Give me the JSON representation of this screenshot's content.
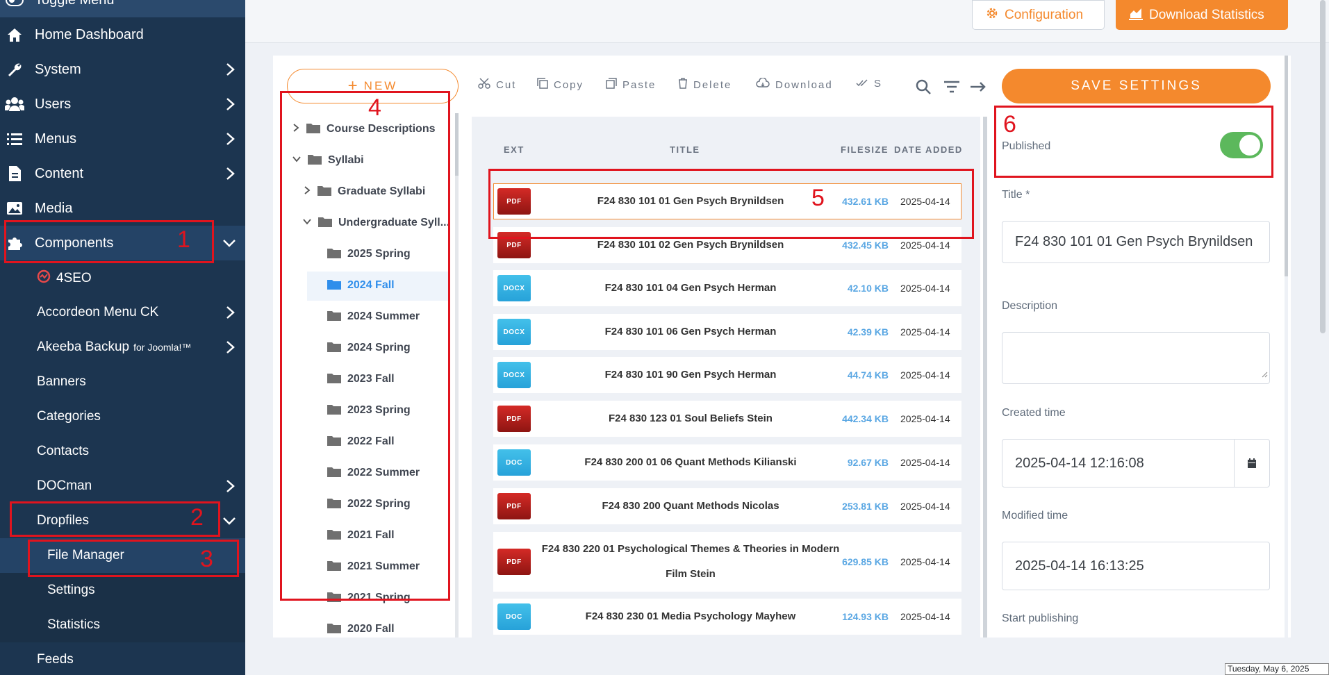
{
  "sidebar": {
    "toggle_label": "Toggle Menu",
    "items": [
      {
        "label": "Home Dashboard",
        "icon": "home-icon"
      },
      {
        "label": "System",
        "icon": "wrench-icon"
      },
      {
        "label": "Users",
        "icon": "users-icon"
      },
      {
        "label": "Menus",
        "icon": "list-icon"
      },
      {
        "label": "Content",
        "icon": "file-icon"
      },
      {
        "label": "Media",
        "icon": "image-icon"
      },
      {
        "label": "Components",
        "icon": "puzzle-icon"
      }
    ],
    "components": {
      "foursEO": "4SEO",
      "accordeon": "Accordeon Menu CK",
      "akeeba": "Akeeba Backup",
      "akeeba_suffix": "for Joomla!™",
      "banners": "Banners",
      "categories": "Categories",
      "contacts": "Contacts",
      "docman": "DOCman",
      "dropfiles": "Dropfiles",
      "file_manager": "File Manager",
      "settings": "Settings",
      "statistics": "Statistics",
      "feeds": "Feeds"
    }
  },
  "topbar": {
    "configuration": "Configuration",
    "download_statistics": "Download Statistics",
    "accent": "#f4892d"
  },
  "toolbar": {
    "new": "NEW",
    "cut": "Cut",
    "copy": "Copy",
    "paste": "Paste",
    "delete": "Delete",
    "download": "Download",
    "s": "S",
    "save": "SAVE SETTINGS"
  },
  "tree": {
    "course_descriptions": "Course Descriptions",
    "syllabi": "Syllabi",
    "graduate": "Graduate Syllabi",
    "undergraduate": "Undergraduate Syll...",
    "terms": [
      "2025 Spring",
      "2024 Fall",
      "2024 Summer",
      "2024 Spring",
      "2023 Fall",
      "2023 Spring",
      "2022 Fall",
      "2022 Summer",
      "2022 Spring",
      "2021 Fall",
      "2021 Summer",
      "2021 Spring",
      "2020 Fall"
    ]
  },
  "files": {
    "headers": {
      "ext": "EXT",
      "title": "TITLE",
      "filesize": "FILESIZE",
      "date": "DATE ADDED"
    },
    "rows": [
      {
        "ext": "PDF",
        "title": "F24 830 101 01 Gen Psych Brynildsen",
        "size": "432.61 KB",
        "date": "2025-04-14"
      },
      {
        "ext": "PDF",
        "title": "F24 830 101 02 Gen Psych Brynildsen",
        "size": "432.45 KB",
        "date": "2025-04-14"
      },
      {
        "ext": "DOCX",
        "title": "F24 830 101 04 Gen Psych Herman",
        "size": "42.10 KB",
        "date": "2025-04-14"
      },
      {
        "ext": "DOCX",
        "title": "F24 830 101 06 Gen Psych Herman",
        "size": "42.39 KB",
        "date": "2025-04-14"
      },
      {
        "ext": "DOCX",
        "title": "F24 830 101 90 Gen Psych Herman",
        "size": "44.74 KB",
        "date": "2025-04-14"
      },
      {
        "ext": "PDF",
        "title": "F24 830 123 01 Soul Beliefs Stein",
        "size": "442.34 KB",
        "date": "2025-04-14"
      },
      {
        "ext": "DOC",
        "title": "F24 830 200 01 06 Quant Methods Kilianski",
        "size": "92.67 KB",
        "date": "2025-04-14"
      },
      {
        "ext": "PDF",
        "title": "F24 830 200 Quant Methods Nicolas",
        "size": "253.81 KB",
        "date": "2025-04-14"
      },
      {
        "ext": "PDF",
        "title": "F24 830 220 01 Psychological Themes & Theories in Modern Film Stein",
        "size": "629.85 KB",
        "date": "2025-04-14"
      },
      {
        "ext": "DOC",
        "title": "F24 830 230 01 Media Psychology Mayhew",
        "size": "124.93 KB",
        "date": "2025-04-14"
      }
    ]
  },
  "details": {
    "published_label": "Published",
    "published": true,
    "title_label": "Title *",
    "title_value": "F24 830 101 01 Gen Psych  Brynildsen",
    "description_label": "Description",
    "created_label": "Created time",
    "created_value": "2025-04-14 12:16:08",
    "modified_label": "Modified time",
    "modified_value": "2025-04-14 16:13:25",
    "start_publishing_label": "Start publishing"
  },
  "annotations": [
    "1",
    "2",
    "3",
    "4",
    "5",
    "6"
  ],
  "status_date": "Tuesday, May 6, 2025"
}
